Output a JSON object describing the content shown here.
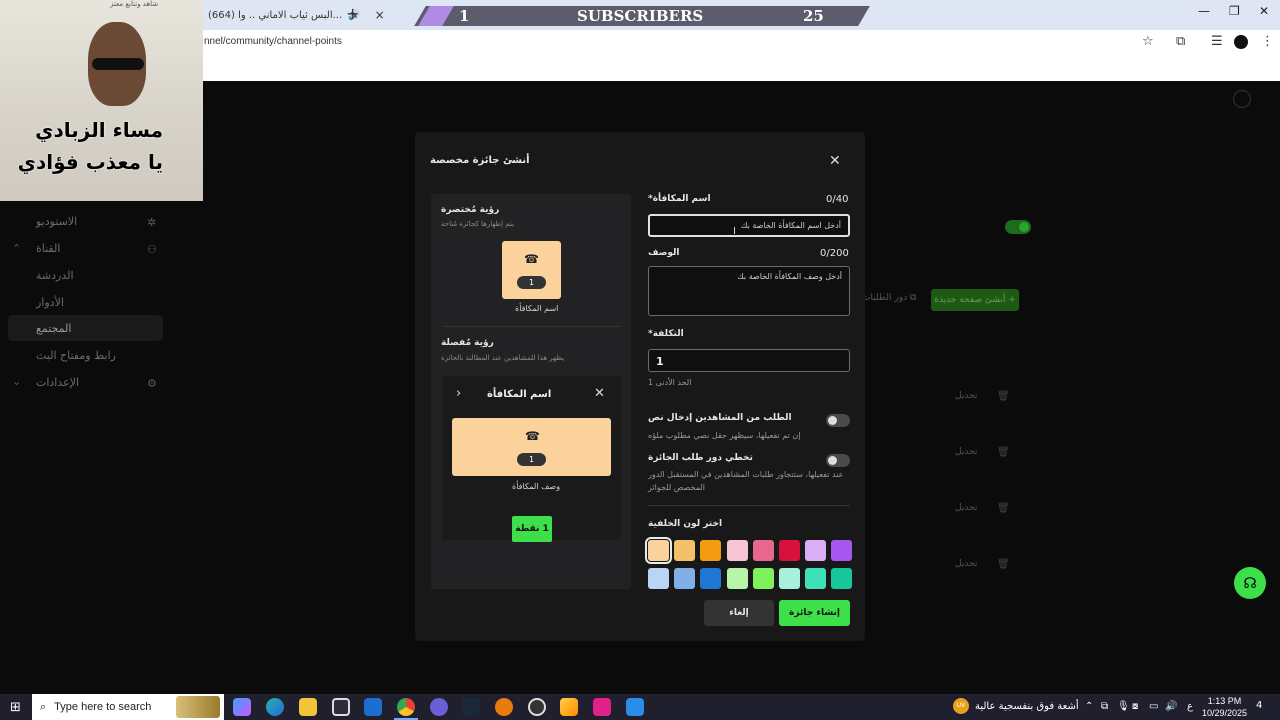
{
  "browser": {
    "tab_title": "(664) البس ثياب الاماني .. وا...",
    "tab_close": "×",
    "new_tab": "+",
    "url": "nnel/community/channel-points",
    "window_controls": [
      "—",
      "❐",
      "✕"
    ]
  },
  "banner": {
    "left_number": "1",
    "label": "SUBSCRIBERS",
    "right_number": "25"
  },
  "video": {
    "top_caption": "شاهد ونتابع معتز",
    "caption_line1": "مساء الزبادي",
    "caption_line2": "يا معذب فؤادي"
  },
  "sidebar": {
    "items": [
      {
        "label": "الاستوديو"
      },
      {
        "label": "القناة"
      },
      {
        "label": "الدردشة"
      },
      {
        "label": "الأدوار"
      },
      {
        "label": "المجتمع"
      },
      {
        "label": "رابط ومفتاح البث"
      },
      {
        "label": "الإعدادات"
      }
    ]
  },
  "background": {
    "create_page_button": "أنشئ صفحة جديدة",
    "queue_link": "دور الطلبات",
    "edit_label": "تحديل"
  },
  "modal": {
    "title": "أنشئ جائزة مخصصة",
    "close": "✕",
    "preview": {
      "compact_heading": "رؤية مُختصرة",
      "compact_sub": "يتم إظهارها كجائزة مُتاحة",
      "compact_cost": "1",
      "compact_name": "اسم المكافأة",
      "detailed_heading": "رؤية مُفصلة",
      "detailed_sub": "يظهر هذا للمشاهدين عند المطالبة بالجائزة",
      "detail_title": "اسم المكافأة",
      "detail_cost": "1",
      "detail_desc": "وصف المكافأة",
      "points_button": "1 نقطة"
    },
    "form": {
      "name_label": "اسم المكافأة*",
      "name_count": "0/40",
      "name_placeholder": "أدخل اسم المكافأة الخاصة بك",
      "desc_label": "الوصف",
      "desc_count": "0/200",
      "desc_placeholder": "أدخل وصف المكافأة الخاصة بك",
      "cost_label": "التكلفة*",
      "cost_value": "1",
      "cost_hint": "الحد الأدنى 1",
      "require_text_label": "الطلب من المشاهدين إدخال نص",
      "require_text_hint": "إن تم تفعيلها، سيظهر حقل نصي مطلوب ملؤه",
      "skip_queue_label": "تخطي دور طلب الجائزة",
      "skip_queue_hint1": "عند تفعيلها، ستتجاوز طلبات المشاهدين في المستقبل الدور",
      "skip_queue_hint2": "المخصص للجوائز",
      "color_label": "اختر لون الخلفية",
      "colors_row1": [
        "#fbd29c",
        "#f5c06a",
        "#f39c12",
        "#f7c5d4",
        "#e8678c",
        "#d90f3c",
        "#d9aef5",
        "#a557f0"
      ],
      "colors_row2": [
        "#b9d4f5",
        "#7fb0e8",
        "#1f77d4",
        "#b9f5a8",
        "#7ef05a",
        "#a6f0dc",
        "#3ee0b8",
        "#16c79a"
      ],
      "cancel": "إلغاء",
      "create": "إنشاء جائزة"
    }
  },
  "taskbar": {
    "search_placeholder": "Type here to search",
    "news_badge": "UV",
    "news_text": "أشعة فوق بنفسجية عالية",
    "lang": "ع",
    "time": "1:13 PM",
    "date": "10/29/2025",
    "notif_count": "4"
  }
}
